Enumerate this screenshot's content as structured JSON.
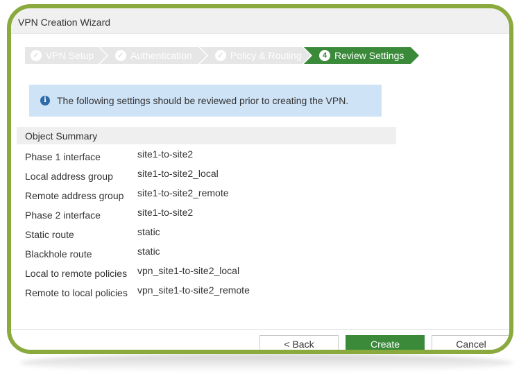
{
  "window": {
    "title": "VPN Creation Wizard"
  },
  "steps": [
    {
      "label": "VPN Setup",
      "state": "done",
      "icon": "check-icon"
    },
    {
      "label": "Authentication",
      "state": "done",
      "icon": "check-icon"
    },
    {
      "label": "Policy & Routing",
      "state": "done",
      "icon": "check-icon"
    },
    {
      "label": "Review Settings",
      "state": "active",
      "number": "4"
    }
  ],
  "info": {
    "icon": "info-icon",
    "text": "The following settings should be reviewed prior to creating the VPN."
  },
  "summary": {
    "header": "Object Summary",
    "rows": [
      {
        "key": "Phase 1 interface",
        "value": "site1-to-site2"
      },
      {
        "key": "Local address group",
        "value": "site1-to-site2_local"
      },
      {
        "key": "Remote address group",
        "value": "site1-to-site2_remote"
      },
      {
        "key": "Phase 2 interface",
        "value": "site1-to-site2"
      },
      {
        "key": "Static route",
        "value": "static"
      },
      {
        "key": "Blackhole route",
        "value": "static"
      },
      {
        "key": "Local to remote policies",
        "value": "vpn_site1-to-site2_local"
      },
      {
        "key": "Remote to local policies",
        "value": "vpn_site1-to-site2_remote"
      }
    ]
  },
  "buttons": {
    "back": "< Back",
    "create": "Create",
    "cancel": "Cancel"
  },
  "colors": {
    "frame": "#8aaa3e",
    "accent_green": "#3a8a3a",
    "info_bg": "#cfe3f7",
    "step_done_bg": "#e6e6e6"
  }
}
